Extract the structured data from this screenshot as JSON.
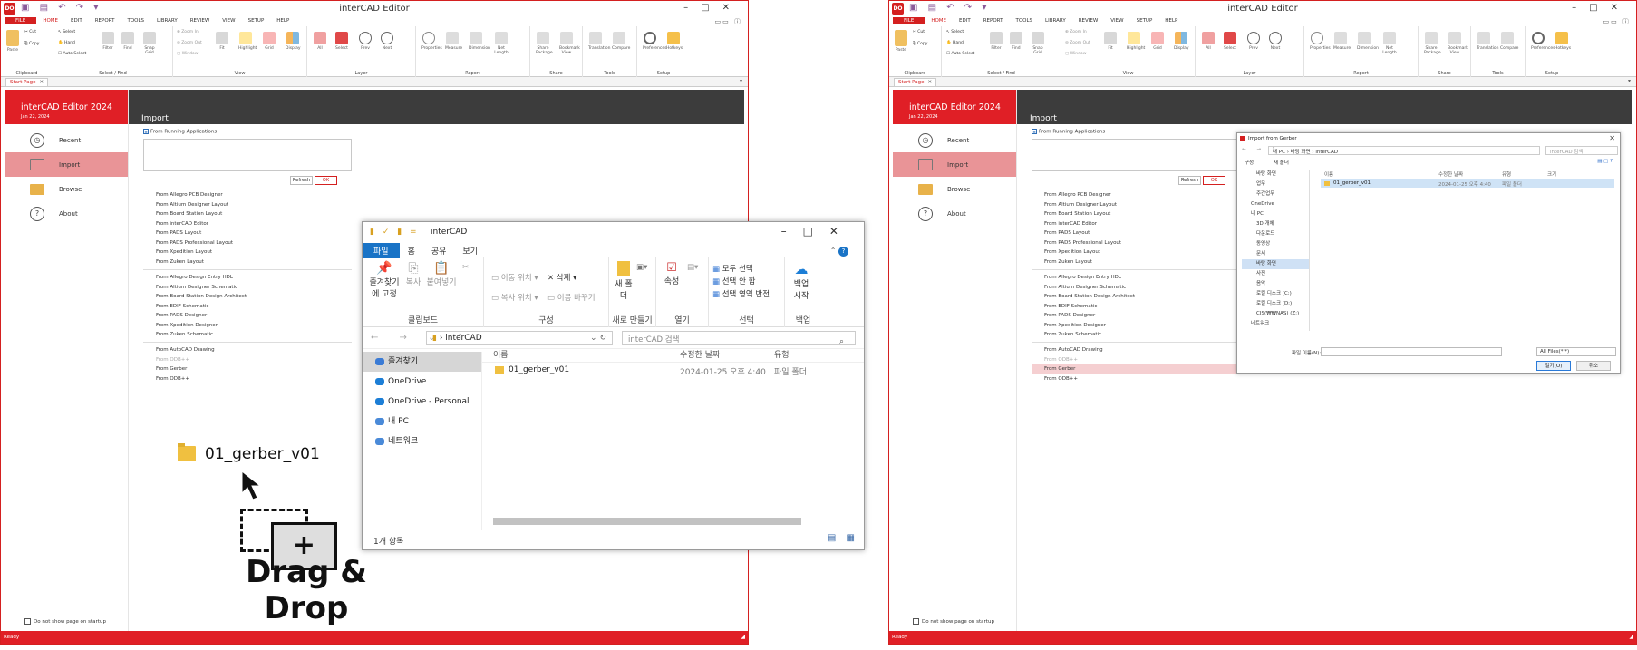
{
  "app": {
    "title": "interCAD Editor",
    "logo": "DO",
    "menu": [
      "FILE",
      "HOME",
      "EDIT",
      "REPORT",
      "TOOLS",
      "LIBRARY",
      "REVIEW",
      "VIEW",
      "SETUP",
      "HELP"
    ],
    "ribbon_groups": [
      "Clipboard",
      "Select / Find",
      "View",
      "Layer",
      "Report",
      "Share",
      "Tools",
      "Setup"
    ],
    "ribbon_buttons": [
      "Paste",
      "Cut",
      "Copy",
      "Select",
      "Hand",
      "Auto Select",
      "Filter",
      "Find",
      "Snap Grid",
      "Zoom In",
      "Zoom Out",
      "Window",
      "Fit",
      "Highlight",
      "Grid",
      "Display",
      "All",
      "Select",
      "Prev",
      "Next",
      "Properties",
      "Measure",
      "Dimension",
      "Net Length",
      "Share Package",
      "Bookmark View",
      "Translation",
      "Compare",
      "Preferences",
      "Hotkeys"
    ],
    "start_tab": "Start Page",
    "brand": "interCAD Editor 2024",
    "brand_date": "Jan 22, 2024",
    "nav": [
      "Recent",
      "Import",
      "Browse",
      "About"
    ],
    "import_heading": "Import",
    "from_running": "From Running Applications",
    "refresh": "Refresh",
    "ok": "OK",
    "group1": [
      "From Allegro PCB Designer",
      "From Altium Designer Layout",
      "From Board Station Layout",
      "From interCAD Editor",
      "From PADS Layout",
      "From PADS Professional Layout",
      "From Xpedition Layout",
      "From Zuken Layout"
    ],
    "group2": [
      "From Allegro Design Entry HDL",
      "From Altium Designer Schematic",
      "From Board Station Design Architect",
      "From EDIF Schematic",
      "From PADS Designer",
      "From Xpedition Designer",
      "From Zuken Schematic"
    ],
    "group3": [
      "From AutoCAD Drawing",
      "From ODB++",
      "From Gerber",
      "From ODB++"
    ],
    "dont_show": "Do not show page on startup",
    "status": "Ready"
  },
  "drag": {
    "folder_name": "01_gerber_v01",
    "label": "Drag & Drop"
  },
  "explorer": {
    "title": "interCAD",
    "tabs": [
      "파일",
      "홈",
      "공유",
      "보기"
    ],
    "pin": "즐겨찾기에 고정",
    "copy": "복사",
    "paste": "붙여넣기",
    "move_to": "이동 위치",
    "copy_to": "복사 위치",
    "delete": "삭제",
    "rename": "이름 바꾸기",
    "new_folder": "새 폴더",
    "properties": "속성",
    "select_all": "모두 선택",
    "select_none": "선택 안 함",
    "invert": "선택 영역 반전",
    "backup": "백업 시작",
    "groups": [
      "클립보드",
      "구성",
      "새로 만들기",
      "열기",
      "선택",
      "백업"
    ],
    "address": "interCAD",
    "search_ph": "interCAD 검색",
    "nav": [
      "즐겨찾기",
      "OneDrive",
      "OneDrive - Personal",
      "내 PC",
      "네트워크"
    ],
    "col_name": "이름",
    "col_date": "수정한 날짜",
    "col_type": "유형",
    "file": {
      "name": "01_gerber_v01",
      "date": "2024-01-25 오후 4:40",
      "type": "파일 폴더"
    },
    "count": "1개 항목"
  },
  "dialog": {
    "title": "Import from Gerber",
    "path": "내 PC  ›  바탕 화면  ›  interCAD",
    "search_ph": "interCAD 검색",
    "organize": "구성",
    "new_folder": "새 폴더",
    "nav": [
      "바탕 화면",
      "업무",
      "주간업무",
      "OneDrive",
      "내 PC",
      "3D 개체",
      "다운로드",
      "동영상",
      "문서",
      "바탕 화면",
      "사진",
      "음악",
      "로컬 디스크 (C:)",
      "로컬 디스크 (D:)",
      "CIS(₩₩NAS) (Z:)",
      "네트워크"
    ],
    "col_name": "이름",
    "col_date": "수정한 날짜",
    "col_type": "유형",
    "col_size": "크기",
    "file": {
      "name": "01_gerber_v01",
      "date": "2024-01-25 오후 4:40",
      "type": "파일 폴더"
    },
    "filename_label": "파일 이름(N):",
    "filter": "All Files(*.*)",
    "open": "열기(O)",
    "cancel": "취소"
  }
}
